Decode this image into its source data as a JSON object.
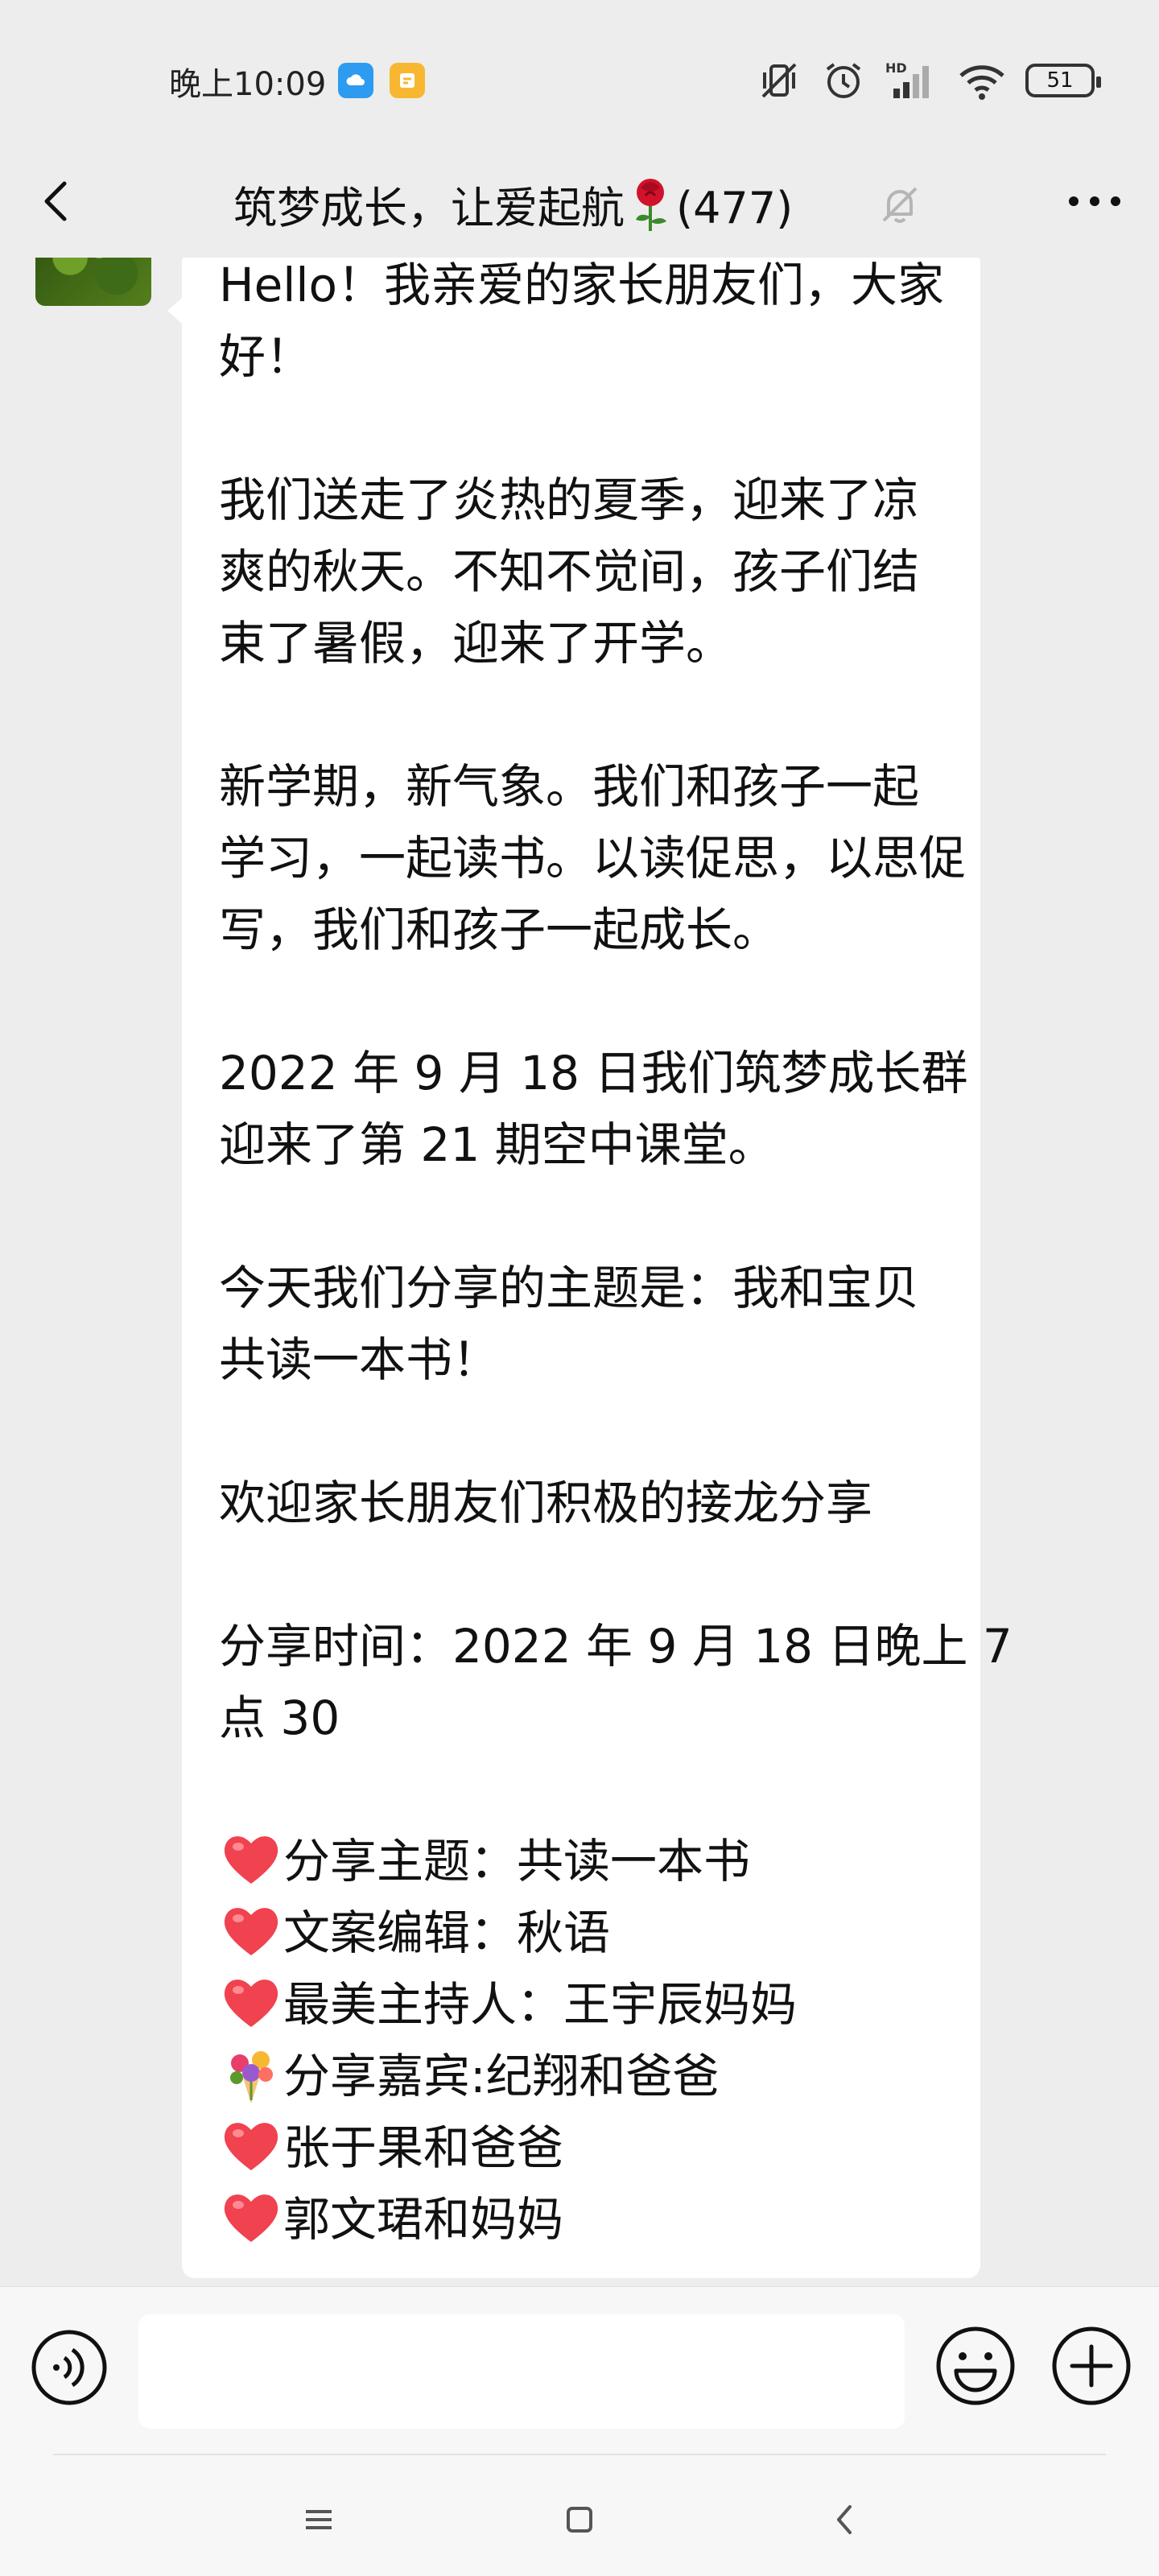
{
  "status_bar": {
    "time": "晚上10:09",
    "battery": "51",
    "network": "HD"
  },
  "header": {
    "title": "筑梦成长，让爱起航",
    "member_count": "(477)"
  },
  "message": {
    "lines": [
      "Hello！我亲爱的家长朋友们，大家",
      "好！",
      "",
      "我们送走了炎热的夏季，迎来了凉",
      "爽的秋天。不知不觉间，孩子们结",
      "束了暑假，迎来了开学。",
      "",
      "新学期，新气象。我们和孩子一起",
      "学习，一起读书。以读促思，以思促",
      "写，我们和孩子一起成长。",
      "",
      "2022 年 9 月 18 日我们筑梦成长群",
      "迎来了第 21 期空中课堂。",
      "",
      "今天我们分享的主题是：我和宝贝",
      "共读一本书！",
      "",
      "欢迎家长朋友们积极的接龙分享",
      "",
      "分享时间：2022 年 9 月 18 日晚上 7",
      "点 30",
      ""
    ],
    "list_items": [
      {
        "icon": "heart",
        "text": "分享主题：共读一本书"
      },
      {
        "icon": "heart",
        "text": "文案编辑：秋语"
      },
      {
        "icon": "heart",
        "text": "最美主持人：王宇辰妈妈"
      },
      {
        "icon": "bouquet",
        "text": "分享嘉宾:纪翔和爸爸"
      },
      {
        "icon": "heart",
        "text": "张于果和爸爸"
      },
      {
        "icon": "heart",
        "text": "郭文珺和妈妈"
      }
    ]
  },
  "input_bar": {
    "text_value": ""
  },
  "icons": {
    "back": "chevron-left-icon",
    "mute": "bell-off-icon",
    "more": "more-dots-icon",
    "voice": "voice-icon",
    "emoji": "smiley-icon",
    "plus": "plus-icon"
  },
  "colors": {
    "background": "#ededed",
    "bubble": "#ffffff",
    "heart": "#f0424f",
    "text": "#111111"
  }
}
